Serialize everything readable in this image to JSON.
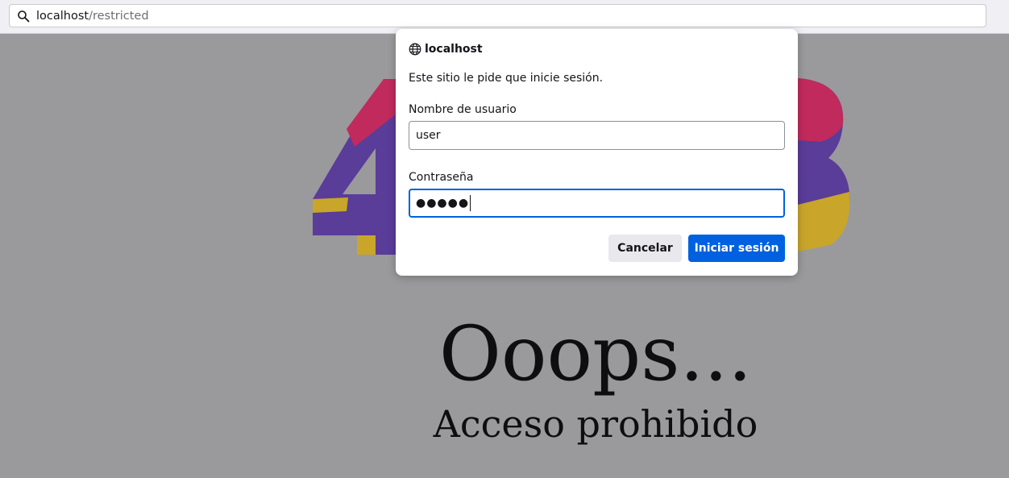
{
  "browser": {
    "url_host": "localhost",
    "url_path": "/restricted",
    "icons": {
      "url_search": "search-icon"
    }
  },
  "page": {
    "title": "Ooops...",
    "subtitle": "Acceso prohibido"
  },
  "auth_dialog": {
    "host": "localhost",
    "message": "Este sitio le pide que inicie sesión.",
    "username_label": "Nombre de usuario",
    "username_value": "user",
    "password_label": "Contraseña",
    "password_mask": "●●●●●",
    "cancel_label": "Cancelar",
    "login_label": "Iniciar sesión",
    "icons": {
      "host": "globe-icon"
    }
  },
  "colors": {
    "accent": "#0061e0",
    "overlay_bg": "#9a9a9c",
    "art_purple": "#5a3c99",
    "art_red": "#c02a5c",
    "art_yellow": "#c9a52a"
  }
}
